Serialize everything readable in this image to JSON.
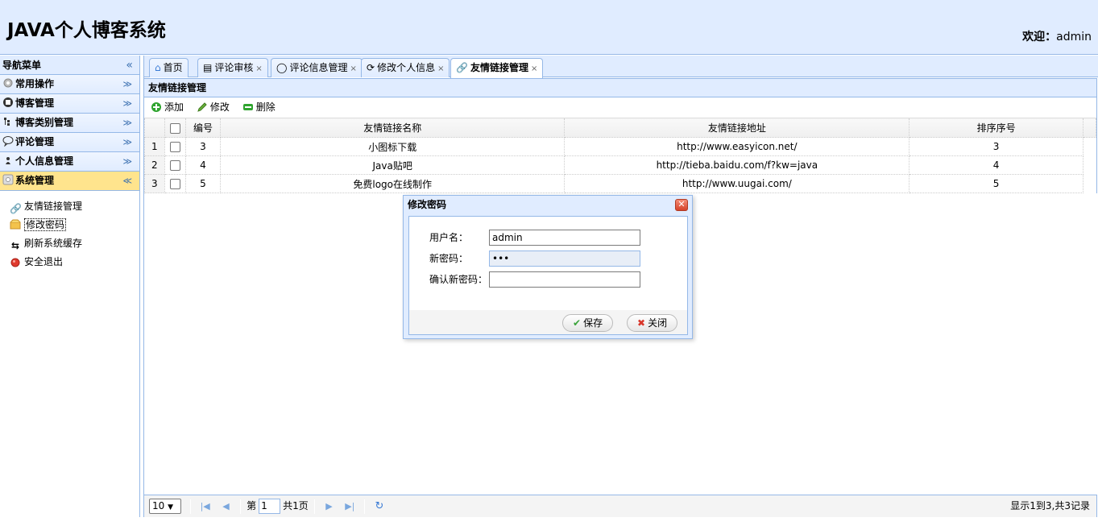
{
  "header": {
    "title": "JAVA个人博客系统",
    "welcome_label": "欢迎：",
    "welcome_user": "admin"
  },
  "nav": {
    "title": "导航菜单",
    "items": [
      {
        "label": "常用操作",
        "icon": "gear-icon"
      },
      {
        "label": "博客管理",
        "icon": "blog-icon"
      },
      {
        "label": "博客类别管理",
        "icon": "category-icon"
      },
      {
        "label": "评论管理",
        "icon": "comment-icon"
      },
      {
        "label": "个人信息管理",
        "icon": "user-icon"
      },
      {
        "label": "系统管理",
        "icon": "system-icon"
      }
    ],
    "sub_items": [
      {
        "label": "友情链接管理",
        "icon": "link-icon"
      },
      {
        "label": "修改密码",
        "icon": "key-icon"
      },
      {
        "label": "刷新系统缓存",
        "icon": "refresh-icon"
      },
      {
        "label": "安全退出",
        "icon": "exit-icon"
      }
    ]
  },
  "tabs": [
    {
      "label": "首页",
      "icon": "home-icon"
    },
    {
      "label": "评论审核",
      "icon": "review-icon"
    },
    {
      "label": "评论信息管理",
      "icon": "comment-icon"
    },
    {
      "label": "修改个人信息",
      "icon": "refresh-icon"
    },
    {
      "label": "友情链接管理",
      "icon": "link-icon"
    }
  ],
  "panel": {
    "title": "友情链接管理"
  },
  "toolbar": {
    "add": "添加",
    "edit": "修改",
    "delete": "删除"
  },
  "grid": {
    "columns": [
      "编号",
      "友情链接名称",
      "友情链接地址",
      "排序序号"
    ],
    "rows": [
      {
        "rn": "1",
        "id": "3",
        "name": "小图标下载",
        "url": "http://www.easyicon.net/",
        "order": "3"
      },
      {
        "rn": "2",
        "id": "4",
        "name": "Java贴吧",
        "url": "http://tieba.baidu.com/f?kw=java",
        "order": "4"
      },
      {
        "rn": "3",
        "id": "5",
        "name": "免费logo在线制作",
        "url": "http://www.uugai.com/",
        "order": "5"
      }
    ]
  },
  "pager": {
    "page_size": "10",
    "page_prefix": "第",
    "page_value": "1",
    "page_suffix": "共1页",
    "info": "显示1到3,共3记录"
  },
  "dialog": {
    "title": "修改密码",
    "username_label": "用户名：",
    "username_value": "admin",
    "new_password_label": "新密码：",
    "new_password_value": "•••",
    "confirm_label": "确认新密码：",
    "confirm_value": "",
    "save": "保存",
    "close": "关闭"
  }
}
